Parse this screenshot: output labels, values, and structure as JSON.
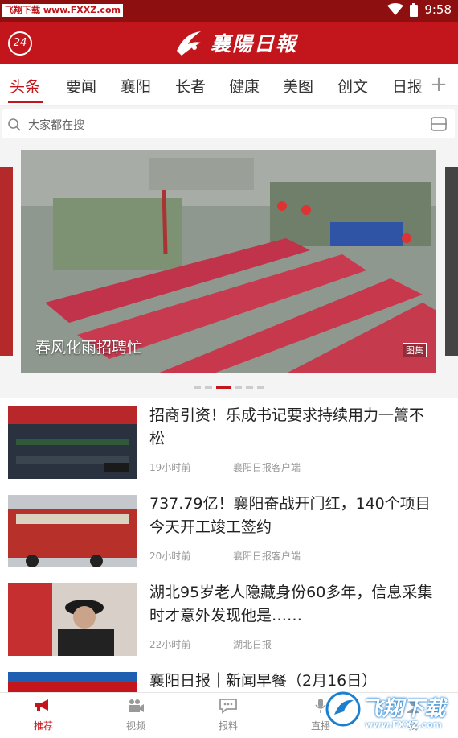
{
  "status_bar": {
    "watermark": "飞翔下载 www.FXXZ.com",
    "time": "9:58"
  },
  "header": {
    "badge": "24",
    "brand": "襄陽日報"
  },
  "tabs": [
    {
      "label": "头条"
    },
    {
      "label": "要闻"
    },
    {
      "label": "襄阳"
    },
    {
      "label": "长者"
    },
    {
      "label": "健康"
    },
    {
      "label": "美图"
    },
    {
      "label": "创文"
    },
    {
      "label": "日报"
    }
  ],
  "tabs_more_icon": "+",
  "search": {
    "placeholder": "大家都在搜"
  },
  "banner": {
    "caption": "春风化雨招聘忙",
    "tag": "图集",
    "active_slide": 3,
    "slide_count": 6
  },
  "news": [
    {
      "title": "招商引资！乐成书记要求持续用力一篙不松",
      "time": "19小时前",
      "source": "襄阳日报客户端"
    },
    {
      "title": "737.79亿！襄阳奋战开门红，140个项目今天开工竣工签约",
      "time": "20小时前",
      "source": "襄阳日报客户端"
    },
    {
      "title": "湖北95岁老人隐藏身份60多年，信息采集时才意外发现他是……",
      "time": "22小时前",
      "source": "湖北日报"
    },
    {
      "title": "襄阳日报｜新闻早餐（2月16日）",
      "time": "",
      "source": ""
    }
  ],
  "bottom_nav": [
    {
      "label": "推荐",
      "icon": "megaphone-icon"
    },
    {
      "label": "视频",
      "icon": "video-camera-icon"
    },
    {
      "label": "报料",
      "icon": "chat-icon"
    },
    {
      "label": "直播",
      "icon": "microphone-icon"
    },
    {
      "label": "我",
      "icon": "person-icon"
    }
  ],
  "watermark_bottom": {
    "text": "飞翔下载",
    "url": "www.FXXZ.com"
  },
  "colors": {
    "brand_red": "#c3161c",
    "status_bar": "#8e0f0f"
  }
}
